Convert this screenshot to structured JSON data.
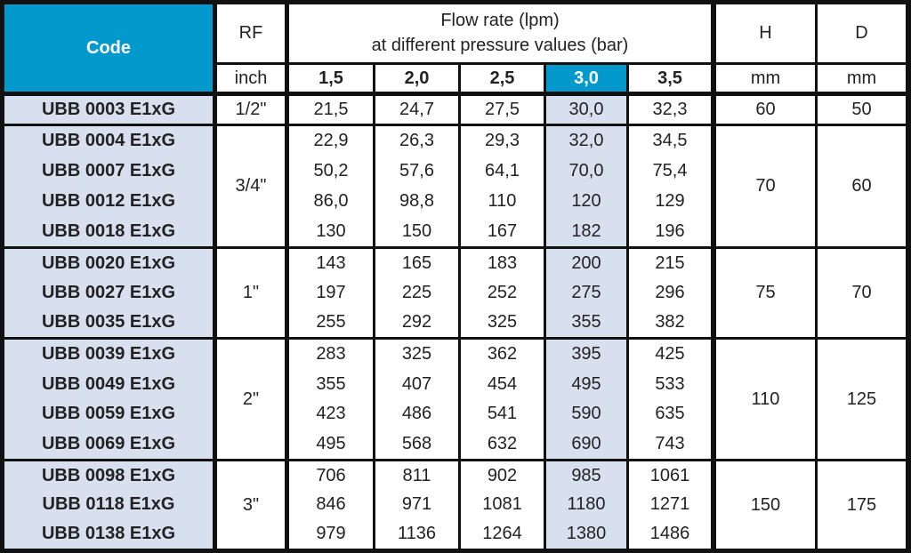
{
  "header": {
    "code": "Code",
    "rf": "RF",
    "rf_unit": "inch",
    "flow_title_line1": "Flow rate (lpm)",
    "flow_title_line2": "at different pressure values (bar)",
    "pressures": [
      "1,5",
      "2,0",
      "2,5",
      "3,0",
      "3,5"
    ],
    "highlighted_pressure": "3,0",
    "h": "H",
    "h_unit": "mm",
    "d": "D",
    "d_unit": "mm"
  },
  "colors": {
    "accent_blue": "#0399cc",
    "highlight_light": "#d8e0f0",
    "border": "#111111"
  },
  "groups": [
    {
      "rf": "1/2\"",
      "h": "60",
      "d": "50",
      "rows": [
        {
          "code": "UBB 0003 E1xG",
          "flow": [
            "21,5",
            "24,7",
            "27,5",
            "30,0",
            "32,3"
          ]
        }
      ]
    },
    {
      "rf": "3/4\"",
      "h": "70",
      "d": "60",
      "rows": [
        {
          "code": "UBB 0004 E1xG",
          "flow": [
            "22,9",
            "26,3",
            "29,3",
            "32,0",
            "34,5"
          ]
        },
        {
          "code": "UBB 0007 E1xG",
          "flow": [
            "50,2",
            "57,6",
            "64,1",
            "70,0",
            "75,4"
          ]
        },
        {
          "code": "UBB 0012 E1xG",
          "flow": [
            "86,0",
            "98,8",
            "110",
            "120",
            "129"
          ]
        },
        {
          "code": "UBB 0018 E1xG",
          "flow": [
            "130",
            "150",
            "167",
            "182",
            "196"
          ]
        }
      ]
    },
    {
      "rf": "1\"",
      "h": "75",
      "d": "70",
      "rows": [
        {
          "code": "UBB 0020 E1xG",
          "flow": [
            "143",
            "165",
            "183",
            "200",
            "215"
          ]
        },
        {
          "code": "UBB 0027 E1xG",
          "flow": [
            "197",
            "225",
            "252",
            "275",
            "296"
          ]
        },
        {
          "code": "UBB 0035 E1xG",
          "flow": [
            "255",
            "292",
            "325",
            "355",
            "382"
          ]
        }
      ]
    },
    {
      "rf": "2\"",
      "h": "110",
      "d": "125",
      "rows": [
        {
          "code": "UBB 0039 E1xG",
          "flow": [
            "283",
            "325",
            "362",
            "395",
            "425"
          ]
        },
        {
          "code": "UBB 0049 E1xG",
          "flow": [
            "355",
            "407",
            "454",
            "495",
            "533"
          ]
        },
        {
          "code": "UBB 0059 E1xG",
          "flow": [
            "423",
            "486",
            "541",
            "590",
            "635"
          ]
        },
        {
          "code": "UBB 0069 E1xG",
          "flow": [
            "495",
            "568",
            "632",
            "690",
            "743"
          ]
        }
      ]
    },
    {
      "rf": "3\"",
      "h": "150",
      "d": "175",
      "rows": [
        {
          "code": "UBB 0098 E1xG",
          "flow": [
            "706",
            "811",
            "902",
            "985",
            "1061"
          ]
        },
        {
          "code": "UBB 0118 E1xG",
          "flow": [
            "846",
            "971",
            "1081",
            "1180",
            "1271"
          ]
        },
        {
          "code": "UBB 0138 E1xG",
          "flow": [
            "979",
            "1136",
            "1264",
            "1380",
            "1486"
          ]
        }
      ]
    }
  ]
}
